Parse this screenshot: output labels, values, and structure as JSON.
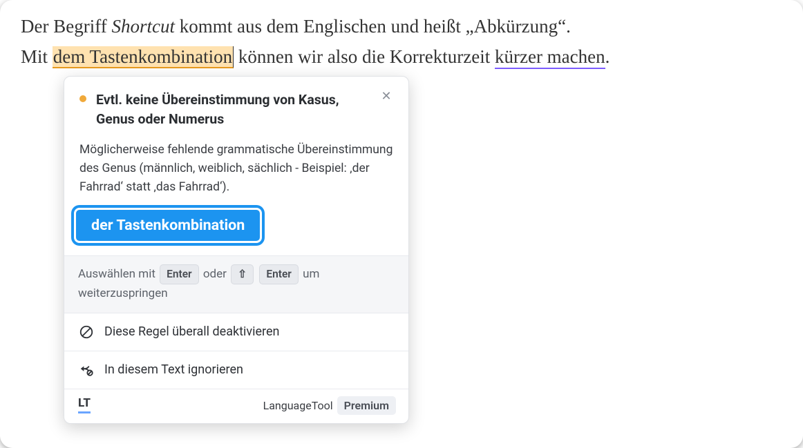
{
  "text": {
    "pre1": "Der Begriff ",
    "italic": "Shortcut",
    "post1": " kommt aus dem Englischen und heißt „Abkürzung“.",
    "line2_pre": "Mit ",
    "highlighted": "dem Tastenkombination",
    "line2_mid": " können wir also die Korrekturzeit ",
    "underlined": "kürzer machen",
    "line2_end": "."
  },
  "popover": {
    "title": "Evtl. keine Übereinstimmung von Kasus, Genus oder Numerus",
    "description": "Möglicherweise fehlende grammatische Übereinstimmung des Genus (männlich, weiblich, sächlich - Beispiel: ‚der Fahrrad‘ statt ‚das Fahrrad‘).",
    "suggestion": "der Tastenkombination",
    "hint_pre": "Auswählen mit ",
    "hint_key1": "Enter",
    "hint_mid": " oder ",
    "hint_shift": "⇧",
    "hint_key2": "Enter",
    "hint_post": " um weiterzuspringen",
    "deactivate": "Diese Regel überall deaktivieren",
    "ignore": "In diesem Text ignorieren",
    "brand": "LanguageTool",
    "premium": "Premium",
    "logo": "LT"
  }
}
